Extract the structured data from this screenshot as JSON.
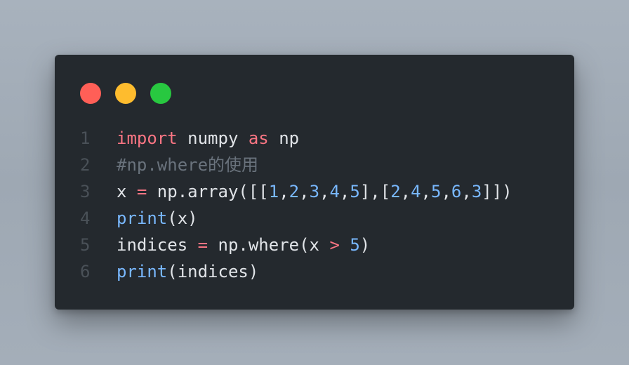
{
  "window": {
    "controls": {
      "close_color": "#ff5f57",
      "minimize_color": "#febc2e",
      "maximize_color": "#28c840"
    }
  },
  "code": {
    "background": "#24292e",
    "lines": [
      {
        "number": "1",
        "tokens": [
          {
            "text": "import",
            "kind": "kw"
          },
          {
            "text": " numpy ",
            "kind": "tx"
          },
          {
            "text": "as",
            "kind": "kw"
          },
          {
            "text": " np",
            "kind": "tx"
          }
        ]
      },
      {
        "number": "2",
        "tokens": [
          {
            "text": "#np.where的使用",
            "kind": "cm"
          }
        ]
      },
      {
        "number": "3",
        "tokens": [
          {
            "text": "x ",
            "kind": "tx"
          },
          {
            "text": "=",
            "kind": "op"
          },
          {
            "text": " np.array([[",
            "kind": "tx"
          },
          {
            "text": "1",
            "kind": "num"
          },
          {
            "text": ",",
            "kind": "tx"
          },
          {
            "text": "2",
            "kind": "num"
          },
          {
            "text": ",",
            "kind": "tx"
          },
          {
            "text": "3",
            "kind": "num"
          },
          {
            "text": ",",
            "kind": "tx"
          },
          {
            "text": "4",
            "kind": "num"
          },
          {
            "text": ",",
            "kind": "tx"
          },
          {
            "text": "5",
            "kind": "num"
          },
          {
            "text": "],[",
            "kind": "tx"
          },
          {
            "text": "2",
            "kind": "num"
          },
          {
            "text": ",",
            "kind": "tx"
          },
          {
            "text": "4",
            "kind": "num"
          },
          {
            "text": ",",
            "kind": "tx"
          },
          {
            "text": "5",
            "kind": "num"
          },
          {
            "text": ",",
            "kind": "tx"
          },
          {
            "text": "6",
            "kind": "num"
          },
          {
            "text": ",",
            "kind": "tx"
          },
          {
            "text": "3",
            "kind": "num"
          },
          {
            "text": "]])",
            "kind": "tx"
          }
        ]
      },
      {
        "number": "4",
        "tokens": [
          {
            "text": "print",
            "kind": "fn"
          },
          {
            "text": "(x)",
            "kind": "tx"
          }
        ]
      },
      {
        "number": "5",
        "tokens": [
          {
            "text": "indices ",
            "kind": "tx"
          },
          {
            "text": "=",
            "kind": "op"
          },
          {
            "text": " np.where(x ",
            "kind": "tx"
          },
          {
            "text": ">",
            "kind": "op"
          },
          {
            "text": " ",
            "kind": "tx"
          },
          {
            "text": "5",
            "kind": "num"
          },
          {
            "text": ")",
            "kind": "tx"
          }
        ]
      },
      {
        "number": "6",
        "tokens": [
          {
            "text": "print",
            "kind": "fn"
          },
          {
            "text": "(indices)",
            "kind": "tx"
          }
        ]
      }
    ]
  }
}
